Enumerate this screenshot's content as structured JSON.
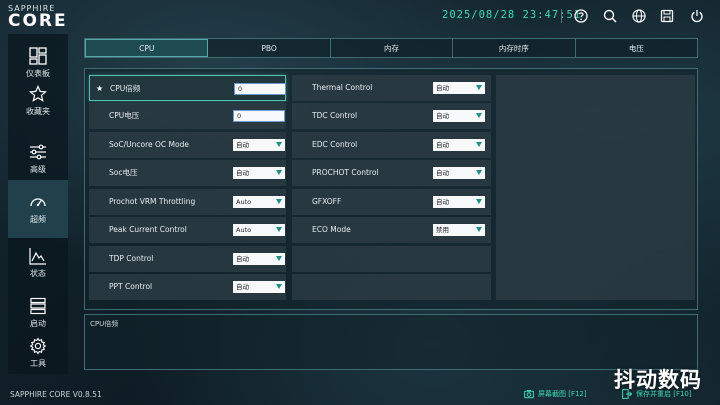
{
  "brand": {
    "top": "SAPPHIRE",
    "bottom": "CORE"
  },
  "header": {
    "datetime": "2025/08/28 23:47:51",
    "icons": [
      "help-icon",
      "search-icon",
      "globe-icon",
      "save-icon",
      "power-icon"
    ],
    "accent_color": "#41d9b3"
  },
  "sidebar": {
    "items": [
      {
        "label": "仪表板",
        "icon": "dashboard-icon"
      },
      {
        "label": "收藏夹",
        "icon": "star-icon"
      },
      {
        "label": "高级",
        "icon": "sliders-icon"
      },
      {
        "label": "超频",
        "icon": "gauge-icon",
        "active": true
      },
      {
        "label": "状态",
        "icon": "chart-icon"
      },
      {
        "label": "启动",
        "icon": "boot-icon"
      },
      {
        "label": "工具",
        "icon": "gear-icon"
      }
    ],
    "version": "SAPPHIRE CORE V0.8.51"
  },
  "tabs": [
    {
      "label": "CPU",
      "active": true
    },
    {
      "label": "PBO"
    },
    {
      "label": "内存"
    },
    {
      "label": "内存时序"
    },
    {
      "label": "电压"
    }
  ],
  "settings": {
    "left": [
      {
        "label": "CPU倍频",
        "type": "input",
        "value": "0",
        "favorite": true
      },
      {
        "label": "CPU电压",
        "type": "input",
        "value": "0"
      },
      {
        "label": "SoC/Uncore OC Mode",
        "type": "select",
        "value": "自动"
      },
      {
        "label": "Soc电压",
        "type": "select",
        "value": "自动"
      },
      {
        "label": "Prochot VRM Throttling",
        "type": "select",
        "value": "Auto"
      },
      {
        "label": "Peak Current Control",
        "type": "select",
        "value": "Auto"
      },
      {
        "label": "TDP Control",
        "type": "select",
        "value": "自动"
      },
      {
        "label": "PPT Control",
        "type": "select",
        "value": "自动"
      }
    ],
    "right": [
      {
        "label": "Thermal Control",
        "type": "select",
        "value": "自动"
      },
      {
        "label": "TDC Control",
        "type": "select",
        "value": "自动"
      },
      {
        "label": "EDC Control",
        "type": "select",
        "value": "自动"
      },
      {
        "label": "PROCHOT Control",
        "type": "select",
        "value": "自动"
      },
      {
        "label": "GFXOFF",
        "type": "select",
        "value": "自动"
      },
      {
        "label": "ECO Mode",
        "type": "select",
        "value": "禁用"
      }
    ]
  },
  "description": {
    "label": "CPU倍频"
  },
  "footer": {
    "screenshot": "屏幕截图 [F12]",
    "save_restart": "保存并重启 [F10]"
  },
  "watermark": "抖动数码"
}
